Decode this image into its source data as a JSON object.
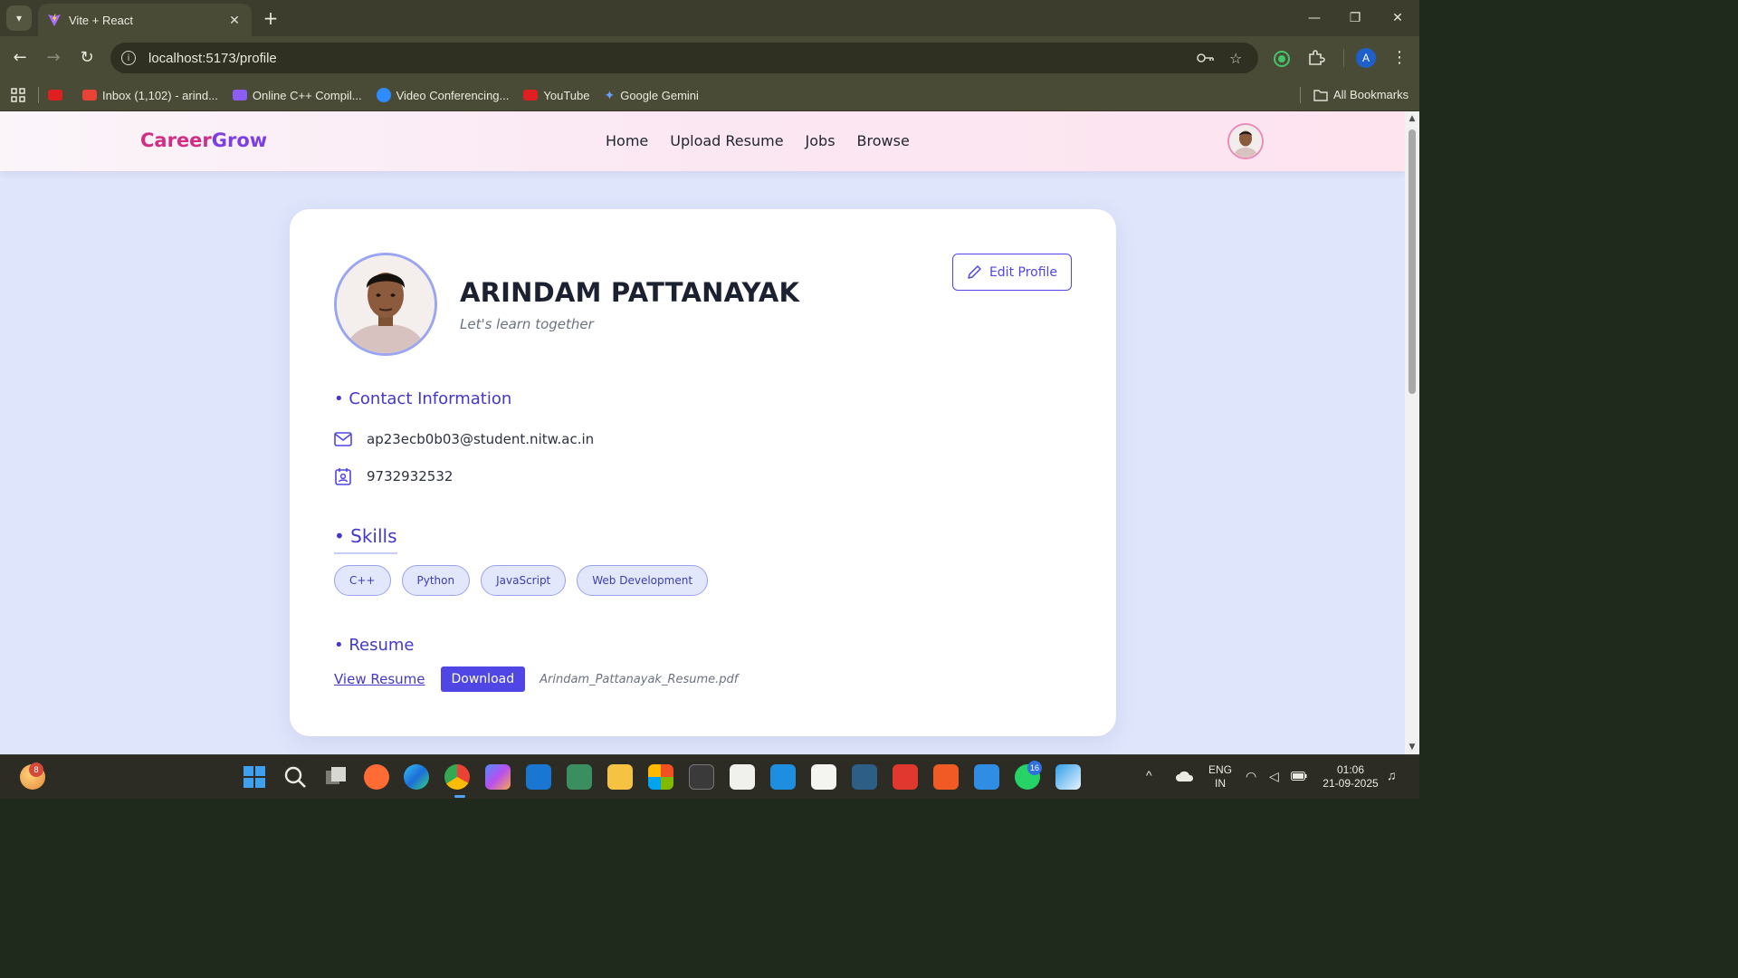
{
  "browser": {
    "tab_title": "Vite + React",
    "url": "localhost:5173/profile",
    "bookmarks": [
      {
        "label": "",
        "color": "#e02020"
      },
      {
        "label": "Inbox (1,102) - arind...",
        "color": "#ea4335"
      },
      {
        "label": "Online C++ Compil...",
        "color": "#8b5cf6"
      },
      {
        "label": "Video Conferencing...",
        "color": "#2d8cff"
      },
      {
        "label": "YouTube",
        "color": "#e02020"
      },
      {
        "label": "Google Gemini",
        "color": "#6aa0f7"
      }
    ],
    "all_bookmarks": "All Bookmarks",
    "profile_initial": "A"
  },
  "navbar": {
    "brand_part1": "Career",
    "brand_part2": "Grow",
    "links": [
      "Home",
      "Upload Resume",
      "Jobs",
      "Browse"
    ]
  },
  "profile": {
    "name": "ARINDAM PATTANAYAK",
    "bio": "Let's learn together",
    "edit_label": "Edit Profile",
    "contact_title": "• Contact Information",
    "email": "ap23ecb0b03@student.nitw.ac.in",
    "phone": "9732932532",
    "skills_title": "• Skills",
    "skills": [
      "C++",
      "Python",
      "JavaScript",
      "Web Development"
    ],
    "resume_title": "• Resume",
    "view_resume": "View Resume",
    "download": "Download",
    "resume_file": "Arindam_Pattanayak_Resume.pdf"
  },
  "taskbar": {
    "weather_badge": "8",
    "whatsapp_badge": "16",
    "lang_line1": "ENG",
    "lang_line2": "IN",
    "time": "01:06",
    "date": "21-09-2025"
  },
  "colors": {
    "accent": "#4f46e5",
    "brand_pink": "#d12f86",
    "brand_purple": "#7b3fe4",
    "page_bg": "#dfe5fb"
  }
}
